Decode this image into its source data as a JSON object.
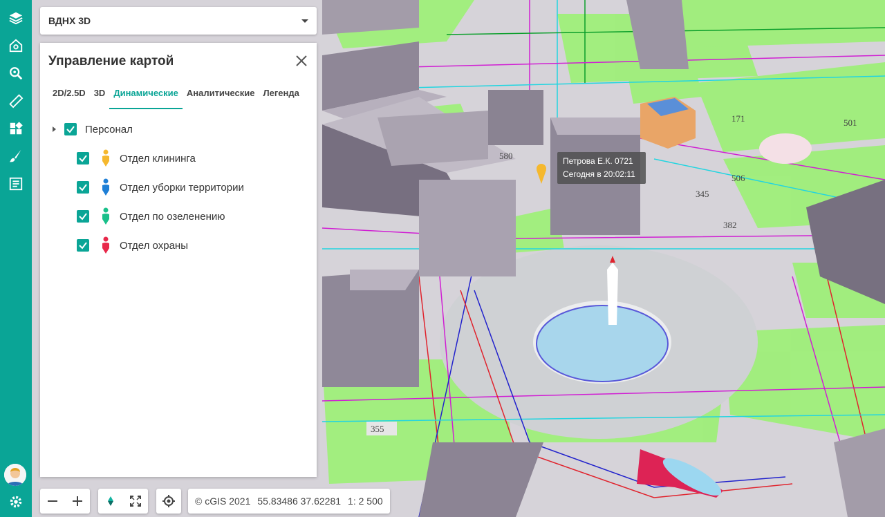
{
  "layer_select": {
    "value": "ВДНХ 3D"
  },
  "panel": {
    "title": "Управление картой",
    "tabs": [
      {
        "label": "2D/2.5D"
      },
      {
        "label": "3D"
      },
      {
        "label": "Динамические",
        "active": true
      },
      {
        "label": "Аналитические"
      },
      {
        "label": "Легенда"
      }
    ],
    "tree": {
      "group": {
        "label": "Персонал",
        "checked": true
      },
      "items": [
        {
          "label": "Отдел клининга",
          "checked": true,
          "color": "#f5b82e"
        },
        {
          "label": "Отдел уборки территории",
          "checked": true,
          "color": "#1e7fd6"
        },
        {
          "label": "Отдел по озеленению",
          "checked": true,
          "color": "#19c08a"
        },
        {
          "label": "Отдел охраны",
          "checked": true,
          "color": "#e8284a"
        }
      ]
    }
  },
  "tooltip": {
    "line1": "Петрова Е.К. 0721",
    "line2": "Сегодня в 20:02:11"
  },
  "status": {
    "copyright": "© cGIS 2021",
    "coords": "55.83486 37.62281",
    "scale": "1: 2 500"
  },
  "map_labels": {
    "a": "355",
    "b": "506",
    "c": "345",
    "d": "580",
    "e": "382",
    "f": "171",
    "g": "501"
  },
  "colors": {
    "accent": "#0aa596",
    "panel_bg": "#ffffff"
  },
  "icons": [
    "layers-icon",
    "home-search-icon",
    "zoom-search-icon",
    "ruler-icon",
    "widgets-icon",
    "brush-icon",
    "list-icon",
    "settings-icon"
  ]
}
